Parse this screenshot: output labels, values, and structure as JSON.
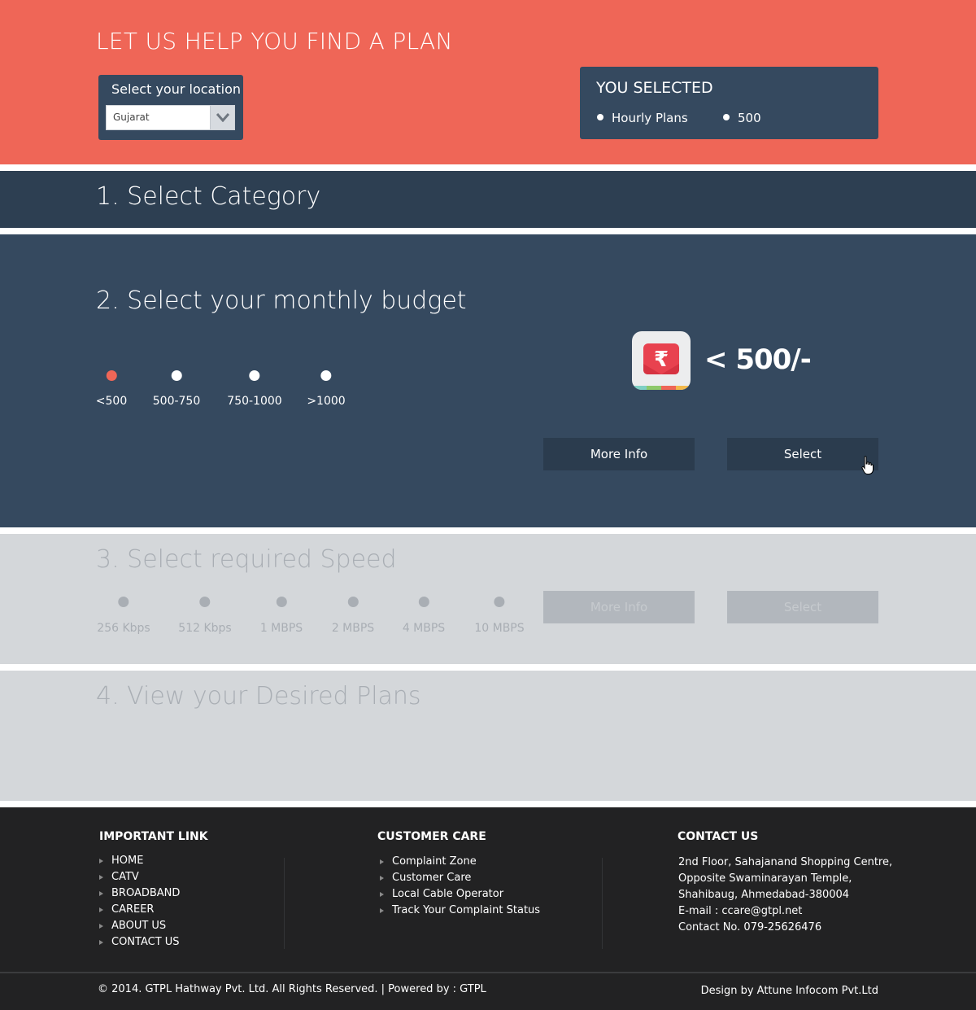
{
  "hero": {
    "title": "LET US HELP YOU FIND A PLAN",
    "location_label": "Select your location",
    "location_value": "Gujarat",
    "selected_title": "YOU SELECTED",
    "selected_items": [
      "Hourly Plans",
      "500"
    ]
  },
  "section1": {
    "title": "1. Select Category"
  },
  "section2": {
    "title": "2. Select your monthly budget",
    "options": [
      "<500",
      "500-750",
      "750-1000",
      ">1000"
    ],
    "active_option": "<500",
    "price": "< 500/-",
    "more_info": "More Info",
    "select": "Select"
  },
  "section3": {
    "title": "3. Select required Speed",
    "options": [
      "256 Kbps",
      "512 Kbps",
      "1 MBPS",
      "2 MBPS",
      "4 MBPS",
      "10 MBPS"
    ],
    "more_info": "More Info",
    "select": "Select"
  },
  "section4": {
    "title": "4. View your Desired Plans"
  },
  "footer": {
    "important_link": {
      "heading": "IMPORTANT LINK",
      "items": [
        "HOME",
        "CATV",
        "BROADBAND",
        "CAREER",
        "ABOUT US",
        "CONTACT US"
      ]
    },
    "customer_care": {
      "heading": "CUSTOMER CARE",
      "items": [
        "Complaint Zone",
        "Customer Care",
        "Local Cable Operator",
        "Track Your Complaint Status"
      ]
    },
    "contact": {
      "heading": "CONTACT US",
      "lines": [
        "2nd Floor, Sahajanand Shopping Centre,",
        "Opposite Swaminarayan Temple,",
        "Shahibaug, Ahmedabad-380004",
        "E-mail :  ccare@gtpl.net",
        "Contact No. 079-25626476"
      ]
    },
    "copyright": "© 2014. GTPL Hathway Pvt. Ltd. All Rights Reserved. | Powered by : GTPL",
    "design_credit": "Design by Attune Infocom Pvt.Ltd"
  },
  "colors": {
    "accent": "#ef6657",
    "panel": "#35495f",
    "panel_dark": "#2d3f52",
    "disabled_bg": "#d4d7da",
    "footer_bg": "#222223"
  },
  "icons": [
    "chevron-down-icon",
    "rupee-wallet-icon",
    "hand-cursor-icon",
    "bullet-arrow-icon"
  ]
}
